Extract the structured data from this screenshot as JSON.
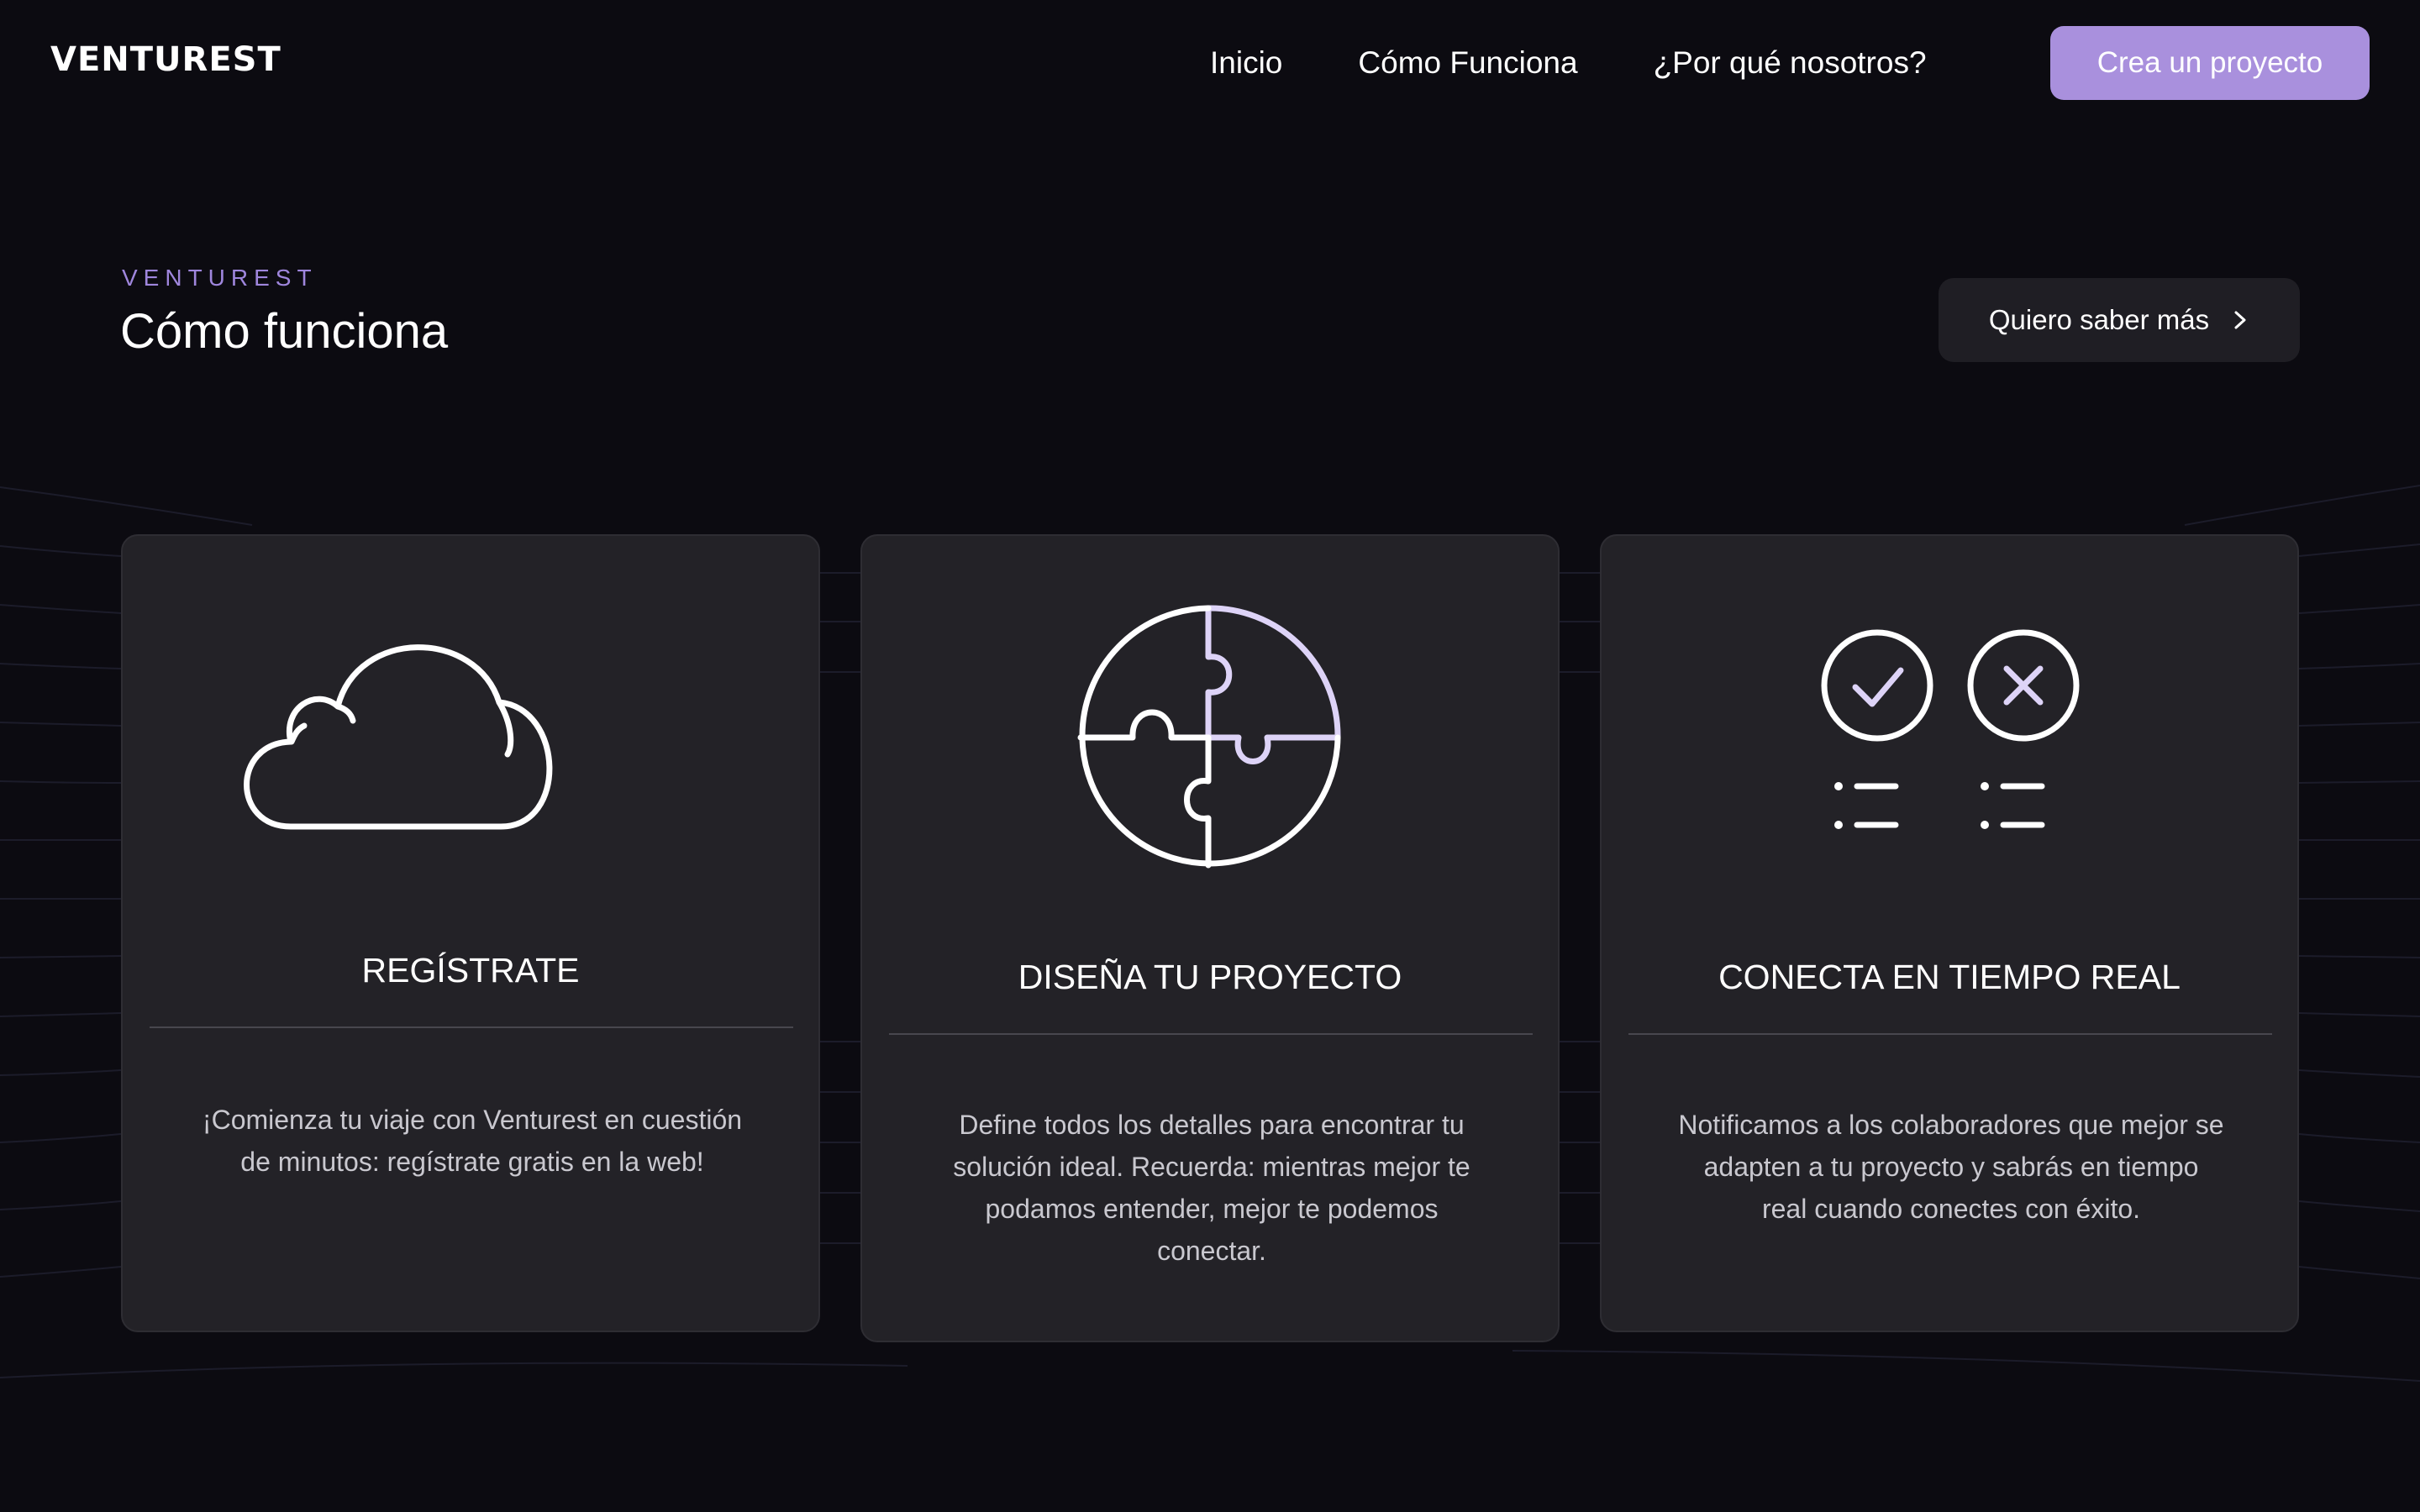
{
  "nav": {
    "logo": "VENTUREST",
    "links": [
      "Inicio",
      "Cómo Funciona",
      "¿Por qué nosotros?"
    ],
    "cta": "Crea un proyecto"
  },
  "section": {
    "eyebrow": "VENTUREST",
    "title": "Cómo funciona",
    "more_button": "Quiero saber más"
  },
  "cards": [
    {
      "icon": "cloud-icon",
      "title": "REGÍSTRATE",
      "text_lines": [
        "¡Comienza tu viaje con Venturest en cuestión",
        "de minutos: regístrate gratis en la web!"
      ]
    },
    {
      "icon": "puzzle-icon",
      "title": "DISEÑA TU PROYECTO",
      "text_lines": [
        "Define todos los detalles para encontrar tu",
        "solución ideal. Recuerda: mientras mejor te",
        "podamos entender, mejor te podemos",
        "conectar."
      ]
    },
    {
      "icon": "check-cross-list-icon",
      "title": "CONECTA EN TIEMPO REAL",
      "text_lines": [
        "Notificamos a los colaboradores que mejor se",
        "adapten a tu proyecto y sabrás en tiempo",
        "real cuando conectes con éxito."
      ]
    }
  ],
  "colors": {
    "background": "#0c0b11",
    "card": "#232227",
    "accent": "#a990dd",
    "accent_light": "#ddd3f7"
  }
}
